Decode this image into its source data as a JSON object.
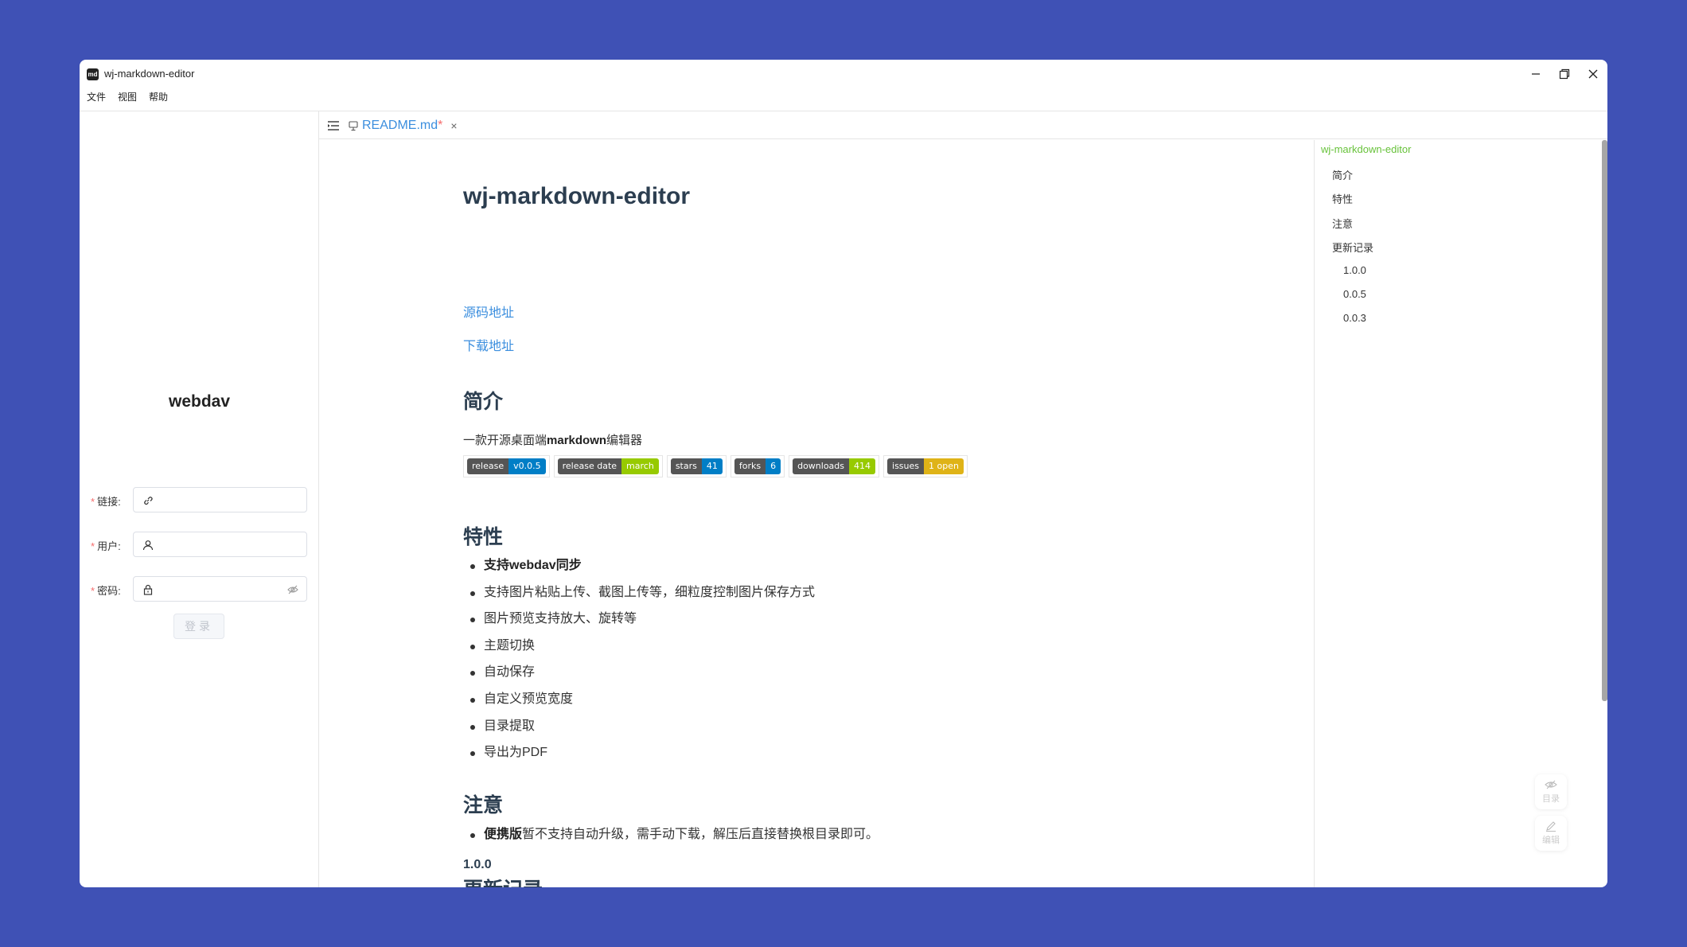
{
  "window": {
    "icon_text": "md",
    "title": "wj-markdown-editor"
  },
  "menu": [
    "文件",
    "视图",
    "帮助"
  ],
  "sidebar": {
    "title": "webdav",
    "fields": {
      "link_label": "链接",
      "user_label": "用户",
      "password_label": "密码",
      "link_value": "",
      "user_value": "",
      "password_value": ""
    },
    "login_button": "登录"
  },
  "tab": {
    "label": "README.md",
    "dirty_marker": "*",
    "close": "×"
  },
  "document": {
    "title": "wj-markdown-editor",
    "links": [
      "源码地址",
      "下载地址"
    ],
    "intro_heading": "简介",
    "intro_prefix": "一款开源桌面端",
    "intro_bold": "markdown",
    "intro_suffix": "编辑器",
    "badges": [
      {
        "label": "release",
        "value": "v0.0.5",
        "color": "#007ec6"
      },
      {
        "label": "release date",
        "value": "march",
        "color": "#97ca00"
      },
      {
        "label": "stars",
        "value": "41",
        "color": "#007ec6"
      },
      {
        "label": "forks",
        "value": "6",
        "color": "#007ec6"
      },
      {
        "label": "downloads",
        "value": "414",
        "color": "#97ca00"
      },
      {
        "label": "issues",
        "value": "1 open",
        "color": "#dfb317"
      }
    ],
    "features_heading": "特性",
    "features_first": "支持webdav同步",
    "features": [
      "支持图片粘贴上传、截图上传等，细粒度控制图片保存方式",
      "图片预览支持放大、旋转等",
      "主题切换",
      "自动保存",
      "自定义预览宽度",
      "目录提取",
      "导出为PDF"
    ],
    "notes_heading": "注意",
    "note_bold": "便携版",
    "note_text": "暂不支持自动升级，需手动下载，解压后直接替换根目录即可。",
    "changelog_heading": "更新记录",
    "changelog_version": "1.0.0"
  },
  "outline": {
    "root": "wj-markdown-editor",
    "items": [
      "简介",
      "特性",
      "注意",
      "更新记录"
    ],
    "sub_items": [
      "1.0.0",
      "0.0.5",
      "0.0.3"
    ]
  },
  "float_buttons": {
    "toc": "目录",
    "edit": "编辑"
  },
  "colors": {
    "background": "#3f51b5",
    "link": "#3b8ede",
    "active_outline": "#67c23a",
    "required": "#f56c6c"
  }
}
